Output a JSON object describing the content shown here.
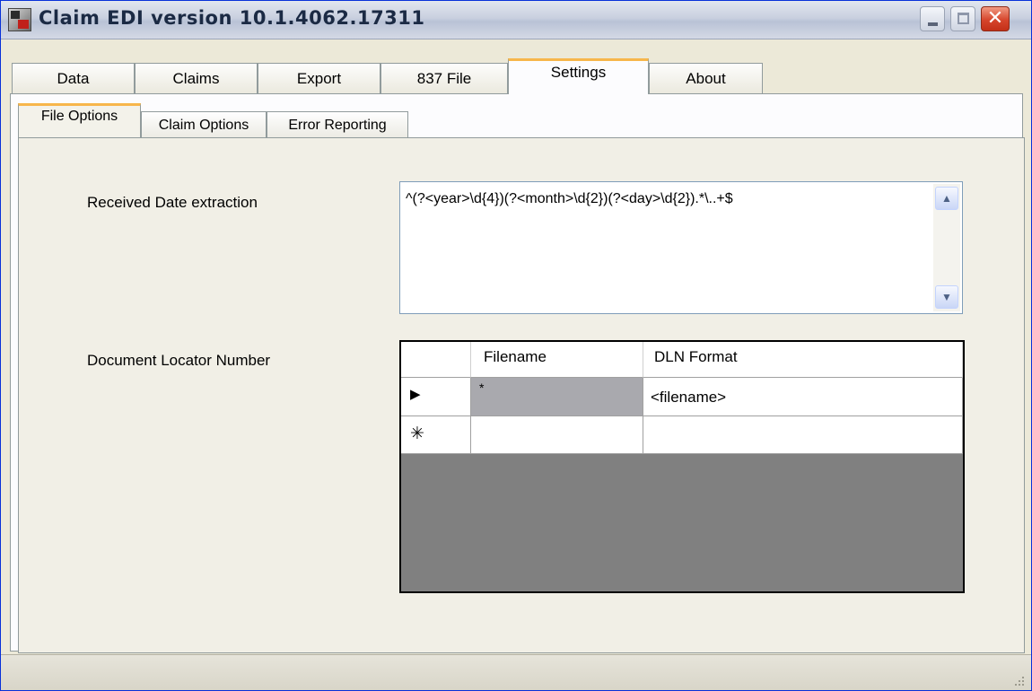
{
  "window": {
    "title": "Claim EDI version 10.1.4062.17311",
    "close_glyph": "✕"
  },
  "main_tabs": [
    {
      "label": "Data"
    },
    {
      "label": "Claims"
    },
    {
      "label": "Export"
    },
    {
      "label": "837 File"
    },
    {
      "label": "Settings",
      "active": true
    },
    {
      "label": "About"
    }
  ],
  "sub_tabs": [
    {
      "label": "File Options",
      "active": true
    },
    {
      "label": "Claim Options"
    },
    {
      "label": "Error Reporting"
    }
  ],
  "file_options": {
    "received_date_label": "Received Date extraction",
    "received_date_value": "^(?<year>\\d{4})(?<month>\\d{2})(?<day>\\d{2}).*\\..+$",
    "dln_label": "Document Locator Number",
    "scroll_up_glyph": "▲",
    "scroll_down_glyph": "▼"
  },
  "dln_grid": {
    "columns": [
      "Filename",
      "DLN Format"
    ],
    "rows": [
      {
        "marker": "▶",
        "filename": "*",
        "dln_format": "<filename>"
      },
      {
        "marker": "✳",
        "filename": "",
        "dln_format": ""
      }
    ]
  },
  "colors": {
    "active_tab_accent": "#f7b64b",
    "grid_background": "#808080",
    "window_background": "#ece9d8"
  }
}
